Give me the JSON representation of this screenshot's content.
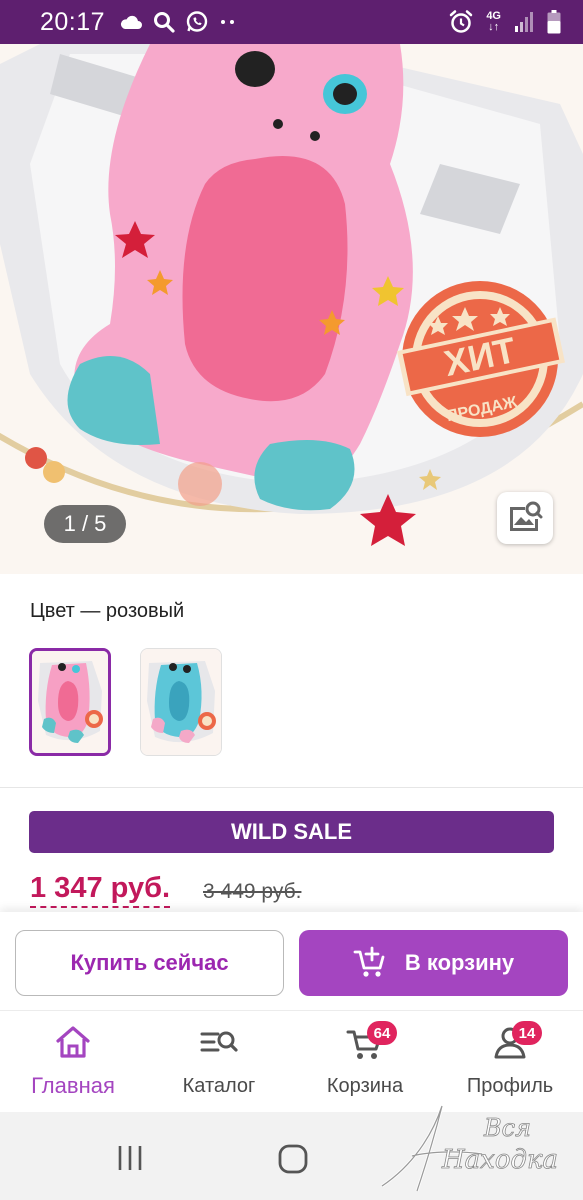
{
  "status_bar": {
    "time": "20:17",
    "left_icons": [
      "cloud-icon",
      "search-icon",
      "whatsapp-icon",
      "more-dots-icon"
    ],
    "right_icons": [
      "alarm-icon",
      "network-4g-icon",
      "signal-icon",
      "battery-icon"
    ],
    "network_label": "4G"
  },
  "gallery": {
    "counter": "1 / 5",
    "badge_top": "ХИТ",
    "badge_bottom": "ПРОДАЖ"
  },
  "color": {
    "label": "Цвет — розовый",
    "options": [
      {
        "name": "розовый",
        "selected": true,
        "color": "#f48fb1"
      },
      {
        "name": "голубой",
        "selected": false,
        "color": "#5cc6d8"
      }
    ]
  },
  "promo": {
    "sale_label": "WILD SALE"
  },
  "price": {
    "current": "1 347 руб.",
    "old": "3 449 руб."
  },
  "actions": {
    "buy_now": "Купить сейчас",
    "add_to_cart": "В корзину"
  },
  "bottom_nav": {
    "items": [
      {
        "label": "Главная",
        "icon": "home-icon",
        "active": true
      },
      {
        "label": "Каталог",
        "icon": "catalog-search-icon",
        "active": false
      },
      {
        "label": "Корзина",
        "icon": "cart-icon",
        "active": false,
        "badge": "64"
      },
      {
        "label": "Профиль",
        "icon": "profile-icon",
        "active": false,
        "badge": "14"
      }
    ]
  },
  "watermark": {
    "line1": "Вся",
    "line2": "Находка"
  },
  "colors": {
    "status_bar": "#5e1f6f",
    "accent": "#a445c0",
    "sale_bg": "#6b2d8a",
    "price": "#c2185b",
    "badge": "#e0245e"
  }
}
